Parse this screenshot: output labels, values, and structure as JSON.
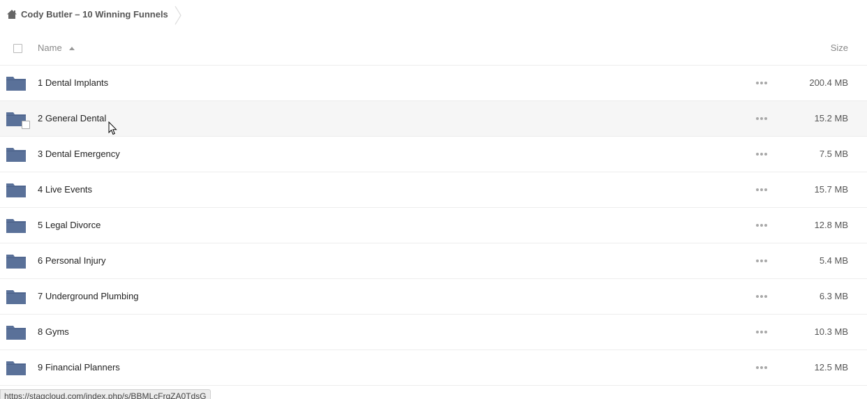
{
  "breadcrumb": {
    "home_icon": "home-icon",
    "title": "Cody Butler – 10 Winning Funnels"
  },
  "header": {
    "name_label": "Name",
    "size_label": "Size",
    "sort_icon": "sort-ascending-icon"
  },
  "colors": {
    "folder": "#5a7199",
    "row_hover": "#f6f6f6",
    "divider": "#ededed"
  },
  "files": [
    {
      "name": "1 Dental Implants",
      "size": "200.4 MB",
      "icon": "folder-icon"
    },
    {
      "name": "2 General Dental",
      "size": "15.2 MB",
      "icon": "folder-icon",
      "hovered": true
    },
    {
      "name": "3 Dental Emergency",
      "size": "7.5 MB",
      "icon": "folder-icon"
    },
    {
      "name": "4 Live Events",
      "size": "15.7 MB",
      "icon": "folder-icon"
    },
    {
      "name": "5 Legal Divorce",
      "size": "12.8 MB",
      "icon": "folder-icon"
    },
    {
      "name": "6 Personal Injury",
      "size": "5.4 MB",
      "icon": "folder-icon"
    },
    {
      "name": "7 Underground Plumbing",
      "size": "6.3 MB",
      "icon": "folder-icon"
    },
    {
      "name": "8 Gyms",
      "size": "10.3 MB",
      "icon": "folder-icon"
    },
    {
      "name": "9 Financial Planners",
      "size": "12.5 MB",
      "icon": "folder-icon"
    }
  ],
  "status_bar": {
    "url": "https://stagcloud.com/index.php/s/BBMLcFrqZA0TdsG"
  }
}
